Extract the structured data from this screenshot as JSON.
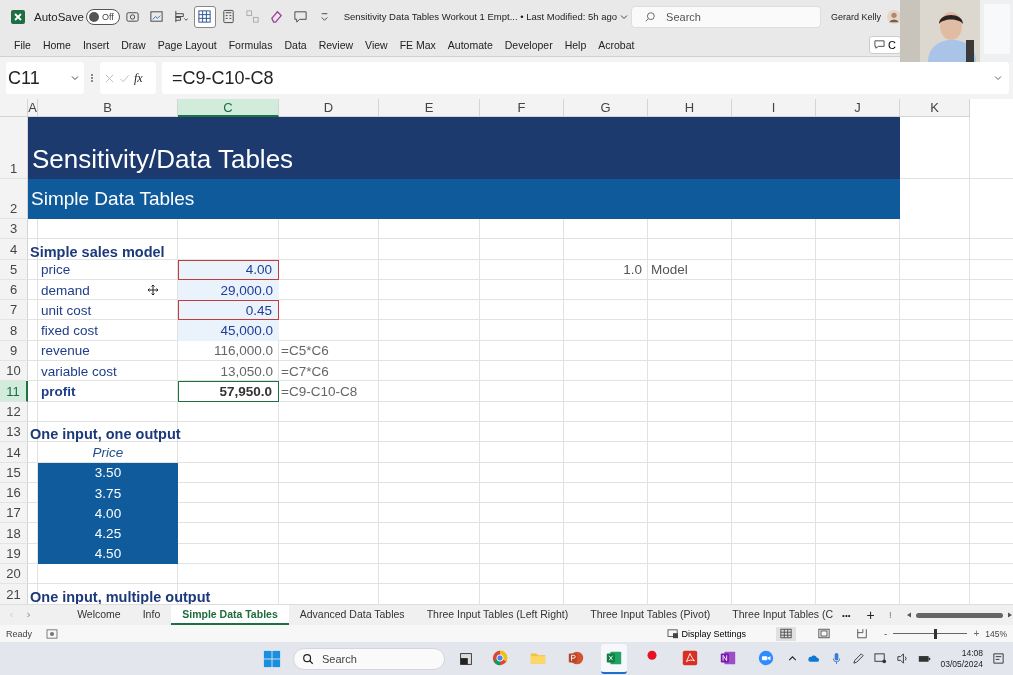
{
  "title_bar": {
    "autosave_label": "AutoSave",
    "autosave_toggle": {
      "on": false,
      "text": "Off"
    },
    "quick_access_tools": [
      {
        "selected": false
      },
      {
        "selected": false
      },
      {
        "selected": false
      },
      {
        "selected": true
      },
      {
        "selected": false
      },
      {
        "selected": false
      },
      {
        "selected": false
      },
      {
        "selected": false
      },
      {
        "selected": false
      }
    ],
    "document_title": "Sensitivity Data Tables Workout 1 Empt... • Last Modified: 5h ago",
    "search": {
      "placeholder": "Search"
    },
    "user_name": "Gerard Kelly"
  },
  "ribbon_tabs": [
    "File",
    "Home",
    "Insert",
    "Draw",
    "Page Layout",
    "Formulas",
    "Data",
    "Review",
    "View",
    "FE Max",
    "Automate",
    "Developer",
    "Help",
    "Acrobat"
  ],
  "comments_button": "C",
  "formula_bar": {
    "name_box": "C11",
    "function_label": "fx",
    "formula": "=C9-C10-C8"
  },
  "sheet": {
    "columns": [
      {
        "label": "A",
        "selected": false
      },
      {
        "label": "B",
        "selected": false
      },
      {
        "label": "C",
        "selected": true
      },
      {
        "label": "D",
        "selected": false
      },
      {
        "label": "E",
        "selected": false
      },
      {
        "label": "F",
        "selected": false
      },
      {
        "label": "G",
        "selected": false
      },
      {
        "label": "H",
        "selected": false
      },
      {
        "label": "I",
        "selected": false
      },
      {
        "label": "J",
        "selected": false
      },
      {
        "label": "K",
        "selected": false
      }
    ],
    "rows": [
      {
        "number": "1",
        "selected": false,
        "cells": {
          "A": {
            "kind": "title",
            "text": "Sensitivity/Data Tables"
          }
        }
      },
      {
        "number": "2",
        "selected": false,
        "cells": {
          "A": {
            "kind": "subtitle",
            "text": "Simple Data Tables"
          }
        }
      },
      {
        "number": "3",
        "selected": false,
        "cells": {}
      },
      {
        "number": "4",
        "selected": false,
        "cells": {
          "A": {
            "kind": "heading",
            "text": "Simple sales model"
          }
        }
      },
      {
        "number": "5",
        "selected": false,
        "cells": {
          "B": {
            "kind": "label",
            "text": "price"
          },
          "C": {
            "kind": "input",
            "text": "4.00",
            "flagged": true
          },
          "G": {
            "kind": "number",
            "text": "1.0"
          },
          "H": {
            "kind": "note",
            "text": "Model"
          }
        }
      },
      {
        "number": "6",
        "selected": false,
        "cells": {
          "B": {
            "kind": "label",
            "text": "demand"
          },
          "C": {
            "kind": "input",
            "text": "29,000.0",
            "flagged": false
          }
        }
      },
      {
        "number": "7",
        "selected": false,
        "cells": {
          "B": {
            "kind": "label",
            "text": "unit cost"
          },
          "C": {
            "kind": "input",
            "text": "0.45",
            "flagged": true
          }
        }
      },
      {
        "number": "8",
        "selected": false,
        "cells": {
          "B": {
            "kind": "label",
            "text": "fixed cost"
          },
          "C": {
            "kind": "input",
            "text": "45,000.0",
            "flagged": false
          }
        }
      },
      {
        "number": "9",
        "selected": false,
        "cells": {
          "B": {
            "kind": "label",
            "text": "revenue"
          },
          "C": {
            "kind": "calc",
            "text": "116,000.0"
          },
          "D": {
            "kind": "formula",
            "text": "=C5*C6"
          }
        }
      },
      {
        "number": "10",
        "selected": false,
        "cells": {
          "B": {
            "kind": "label",
            "text": "variable cost"
          },
          "C": {
            "kind": "calc",
            "text": "13,050.0"
          },
          "D": {
            "kind": "formula",
            "text": "=C7*C6"
          }
        }
      },
      {
        "number": "11",
        "selected": true,
        "cells": {
          "B": {
            "kind": "total",
            "text": "profit"
          },
          "C": {
            "kind": "output",
            "text": "57,950.0",
            "selected": true
          },
          "D": {
            "kind": "formula",
            "text": "=C9-C10-C8"
          }
        }
      },
      {
        "number": "12",
        "selected": false,
        "cells": {}
      },
      {
        "number": "13",
        "selected": false,
        "cells": {
          "A": {
            "kind": "heading",
            "text": "One input, one output"
          }
        }
      },
      {
        "number": "14",
        "selected": false,
        "cells": {
          "B": {
            "kind": "thead",
            "text": "Price"
          }
        }
      },
      {
        "number": "15",
        "selected": false,
        "cells": {
          "B": {
            "kind": "tval",
            "text": "3.50"
          }
        }
      },
      {
        "number": "16",
        "selected": false,
        "cells": {
          "B": {
            "kind": "tval",
            "text": "3.75"
          }
        }
      },
      {
        "number": "17",
        "selected": false,
        "cells": {
          "B": {
            "kind": "tval",
            "text": "4.00"
          }
        }
      },
      {
        "number": "18",
        "selected": false,
        "cells": {
          "B": {
            "kind": "tval",
            "text": "4.25"
          }
        }
      },
      {
        "number": "19",
        "selected": false,
        "cells": {
          "B": {
            "kind": "tval",
            "text": "4.50"
          }
        }
      },
      {
        "number": "20",
        "selected": false,
        "cells": {}
      },
      {
        "number": "21",
        "selected": false,
        "cells": {
          "A": {
            "kind": "heading",
            "text": "One input, multiple output"
          }
        }
      }
    ]
  },
  "sheet_tabs": {
    "tabs": [
      {
        "label": "Welcome",
        "selected": false
      },
      {
        "label": "Info",
        "selected": false
      },
      {
        "label": "Simple Data Tables",
        "selected": true
      },
      {
        "label": "Advanced Data Tables",
        "selected": false
      },
      {
        "label": "Three Input Tables (Left Right)",
        "selected": false
      },
      {
        "label": "Three Input Tables (Pivot)",
        "selected": false
      },
      {
        "label": "Three Input Tables (C",
        "selected": false
      }
    ],
    "more": "•••",
    "add": "+"
  },
  "status_bar": {
    "status": "Ready",
    "display_settings": "Display Settings",
    "views": [
      {
        "selected": true
      },
      {
        "selected": false
      },
      {
        "selected": false
      }
    ],
    "zoom_minus": "-",
    "zoom_plus": "+",
    "zoom": {
      "level": 0.57
    },
    "zoom_text": "145%"
  },
  "taskbar": {
    "search": {
      "placeholder": "Search"
    },
    "apps": [
      {
        "active": false
      },
      {
        "active": false
      },
      {
        "active": false
      },
      {
        "active": true
      },
      {
        "active": false
      },
      {
        "active": false
      },
      {
        "active": false
      },
      {
        "active": false
      }
    ],
    "time": "14:08",
    "date": "03/05/2024"
  }
}
